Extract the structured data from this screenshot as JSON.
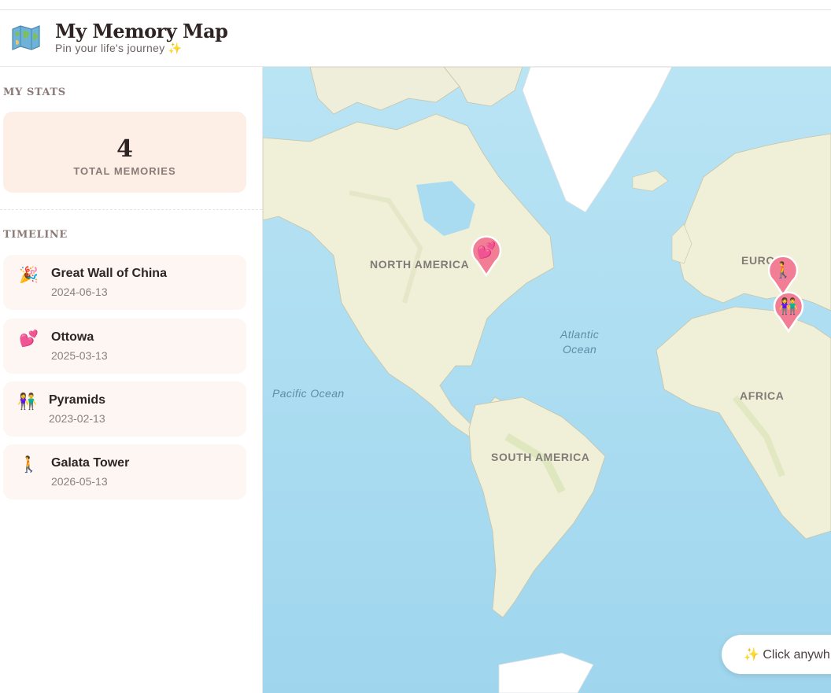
{
  "header": {
    "title": "My Memory Map",
    "subtitle": "Pin your life's journey",
    "subtitle_icon": "✨",
    "logo_icon": "world-map-icon"
  },
  "sidebar": {
    "stats_heading": "MY STATS",
    "stats": {
      "total_count": "4",
      "total_label": "TOTAL MEMORIES"
    },
    "timeline_heading": "TIMELINE",
    "timeline": [
      {
        "title": "Great Wall of China",
        "date": "2024-06-13",
        "emoji": "🎉",
        "icon": "party-popper-icon"
      },
      {
        "title": "Ottowa",
        "date": "2025-03-13",
        "emoji": "💕",
        "icon": "two-hearts-icon"
      },
      {
        "title": "Pyramids",
        "date": "2023-02-13",
        "emoji": "👫",
        "icon": "couple-icon"
      },
      {
        "title": "Galata Tower",
        "date": "2026-05-13",
        "emoji": "🚶",
        "icon": "person-walking-icon"
      }
    ]
  },
  "map": {
    "labels": {
      "north_america": "NORTH AMERICA",
      "south_america": "SOUTH AMERICA",
      "europe": "EURO",
      "africa": "AFRICA",
      "atlantic_1": "Atlantic",
      "atlantic_2": "Ocean",
      "pacific": "Pacific Ocean"
    },
    "pins": [
      {
        "emoji": "💕",
        "icon": "two-hearts-icon"
      },
      {
        "emoji": "🚶",
        "icon": "person-walking-icon"
      },
      {
        "emoji": "👫",
        "icon": "couple-icon"
      }
    ],
    "hint_icon": "✨",
    "hint_text": "Click anywh",
    "colors": {
      "ocean": "#a9dcf0",
      "land": "#f0efd8",
      "ice": "#ffffff",
      "pin": "#f27e95"
    }
  }
}
